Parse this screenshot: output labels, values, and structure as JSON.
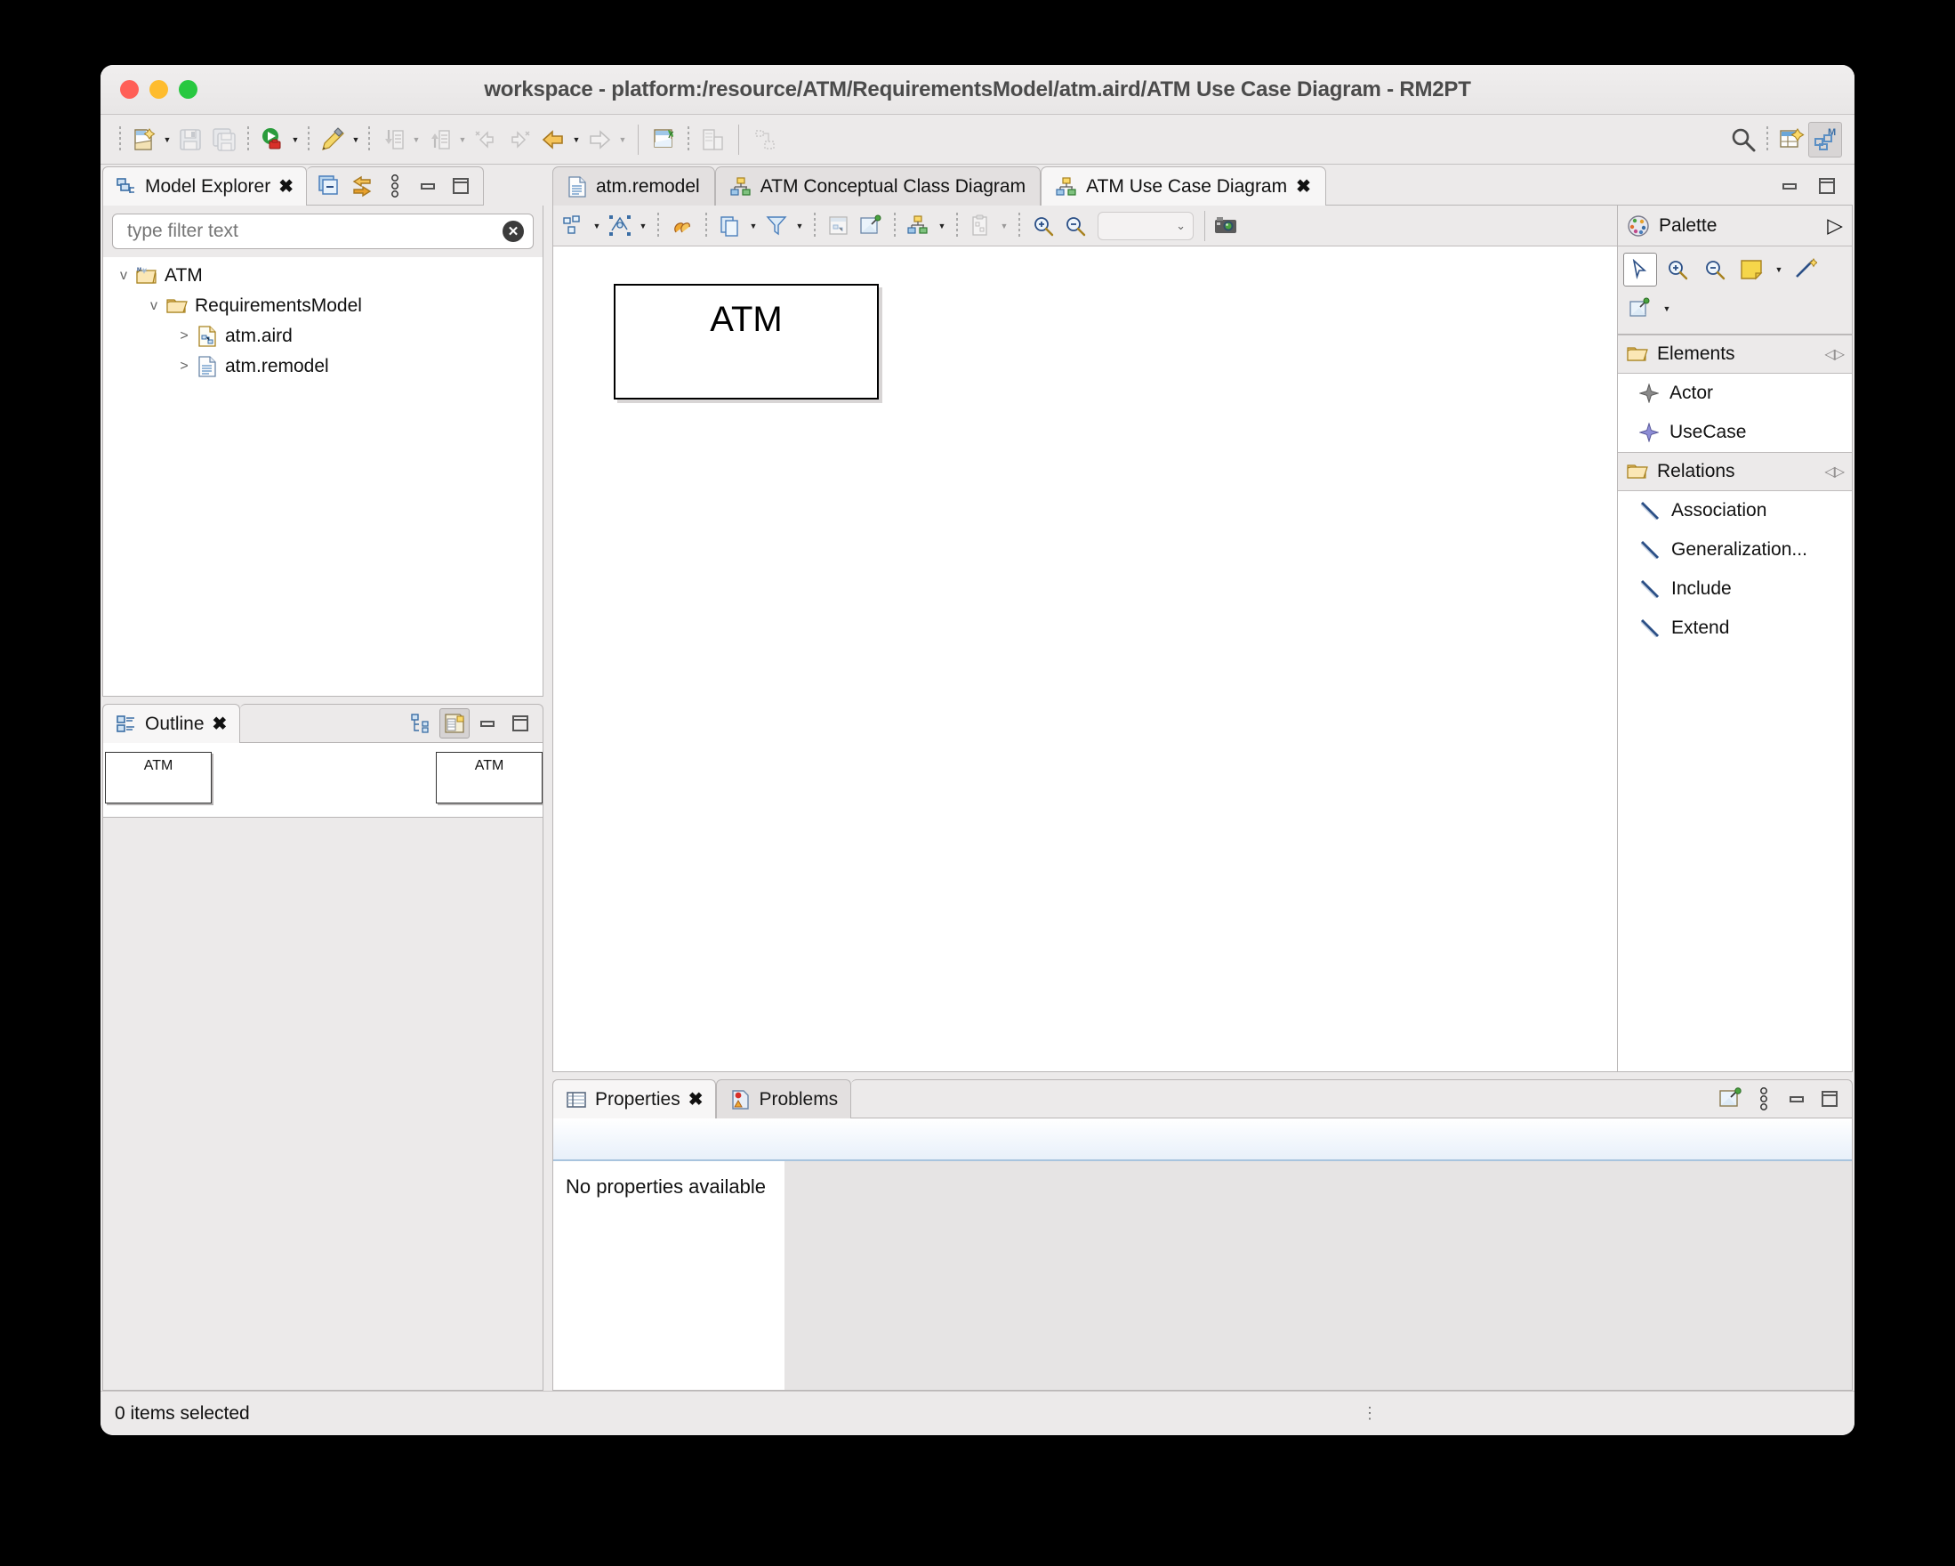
{
  "window": {
    "title": "workspace - platform:/resource/ATM/RequirementsModel/atm.aird/ATM Use Case Diagram - RM2PT",
    "controls": {
      "close": "close",
      "minimize": "minimize",
      "zoom": "zoom"
    }
  },
  "main_toolbar": {
    "items": [
      {
        "name": "new-wizard",
        "label": "New",
        "has_arrow": true,
        "enabled": true
      },
      {
        "name": "save",
        "label": "Save",
        "has_arrow": false,
        "enabled": false
      },
      {
        "name": "save-all",
        "label": "Save All",
        "has_arrow": false,
        "enabled": false
      },
      {
        "name": "run",
        "label": "Run",
        "has_arrow": true,
        "enabled": true
      },
      {
        "name": "debug-pen",
        "label": "Edit",
        "has_arrow": true,
        "enabled": true
      },
      {
        "name": "import",
        "label": "Import",
        "has_arrow": true,
        "enabled": false
      },
      {
        "name": "export",
        "label": "Export",
        "has_arrow": true,
        "enabled": false
      },
      {
        "name": "prev-annotation",
        "label": "Previous Annotation",
        "has_arrow": false,
        "enabled": false
      },
      {
        "name": "next-annotation",
        "label": "Next Annotation",
        "has_arrow": false,
        "enabled": false
      },
      {
        "name": "back",
        "label": "Back",
        "has_arrow": true,
        "enabled": true
      },
      {
        "name": "forward",
        "label": "Forward",
        "has_arrow": true,
        "enabled": false
      },
      {
        "name": "new-diagram",
        "label": "New Diagram",
        "has_arrow": false,
        "enabled": true
      },
      {
        "name": "new-representation",
        "label": "New Representation",
        "has_arrow": false,
        "enabled": false
      },
      {
        "name": "link-layout",
        "label": "Layout",
        "has_arrow": false,
        "enabled": false
      }
    ],
    "right": [
      {
        "name": "search",
        "label": "Search"
      },
      {
        "name": "open-perspective",
        "label": "Open Perspective"
      },
      {
        "name": "modeling-perspective",
        "label": "Modeling",
        "active": true
      }
    ]
  },
  "model_explorer": {
    "tab_label": "Model Explorer",
    "toolbar": [
      {
        "name": "collapse-all",
        "label": "Collapse All"
      },
      {
        "name": "link-with-editor",
        "label": "Link with Editor"
      },
      {
        "name": "view-menu",
        "label": "View Menu"
      },
      {
        "name": "minimize",
        "label": "Minimize"
      },
      {
        "name": "maximize",
        "label": "Maximize"
      }
    ],
    "filter": {
      "value": "",
      "placeholder": "type filter text",
      "clear_label": "Clear"
    },
    "tree": [
      {
        "label": "ATM",
        "icon": "project-icon",
        "depth": 0,
        "expanded": true,
        "twisty": "v"
      },
      {
        "label": "RequirementsModel",
        "icon": "folder-icon",
        "depth": 1,
        "expanded": true,
        "twisty": "v"
      },
      {
        "label": "atm.aird",
        "icon": "aird-file-icon",
        "depth": 2,
        "expanded": false,
        "twisty": ">"
      },
      {
        "label": "atm.remodel",
        "icon": "remodel-file-icon",
        "depth": 2,
        "expanded": false,
        "twisty": ">"
      }
    ]
  },
  "outline": {
    "tab_label": "Outline",
    "toolbar": [
      {
        "name": "tree-outline",
        "label": "Tree Outline",
        "selected": false
      },
      {
        "name": "overview-thumbnail",
        "label": "Overview",
        "selected": true
      },
      {
        "name": "minimize",
        "label": "Minimize",
        "selected": false
      },
      {
        "name": "maximize",
        "label": "Maximize",
        "selected": false
      }
    ],
    "thumbnails": [
      {
        "label": "ATM"
      },
      {
        "label": "ATM"
      }
    ]
  },
  "editor": {
    "tabs": [
      {
        "label": "atm.remodel",
        "icon": "remodel-file-icon",
        "active": false,
        "closable": false
      },
      {
        "label": "ATM Conceptual Class Diagram",
        "icon": "diagram-icon",
        "active": false,
        "closable": false
      },
      {
        "label": "ATM Use Case Diagram",
        "icon": "diagram-icon",
        "active": true,
        "closable": true
      }
    ],
    "window_buttons": [
      {
        "name": "minimize",
        "label": "Minimize"
      },
      {
        "name": "maximize",
        "label": "Maximize"
      }
    ],
    "diagram_toolbar": [
      {
        "name": "arrange-all",
        "label": "Arrange All",
        "has_arrow": true
      },
      {
        "name": "select-all",
        "label": "Select",
        "has_arrow": true
      },
      {
        "name": "refresh-diagram",
        "label": "Refresh",
        "has_arrow": false
      },
      {
        "name": "copy-appearance",
        "label": "Copy Appearance",
        "has_arrow": true
      },
      {
        "name": "filters",
        "label": "Filters",
        "has_arrow": true
      },
      {
        "name": "hide-element",
        "label": "Hide Element",
        "has_arrow": false
      },
      {
        "name": "pin-element",
        "label": "Pin Element",
        "has_arrow": false
      },
      {
        "name": "layers",
        "label": "Layers",
        "has_arrow": true
      },
      {
        "name": "paste-format",
        "label": "Paste Format",
        "has_arrow": true
      },
      {
        "name": "zoom-in",
        "label": "Zoom In",
        "has_arrow": false
      },
      {
        "name": "zoom-out",
        "label": "Zoom Out",
        "has_arrow": false
      }
    ],
    "zoom_combo": {
      "value": "",
      "name": "zoom-level-combo"
    },
    "screenshot_button": {
      "name": "export-image",
      "label": "Export as Image"
    },
    "canvas": {
      "nodes": [
        {
          "label": "ATM",
          "type": "package"
        }
      ]
    }
  },
  "palette": {
    "title": "Palette",
    "expand_label": "Show Palette",
    "tools": [
      {
        "name": "select-tool",
        "label": "Select",
        "selected": true
      },
      {
        "name": "zoom-in-tool",
        "label": "Zoom In",
        "selected": false
      },
      {
        "name": "zoom-out-tool",
        "label": "Zoom Out",
        "selected": false
      },
      {
        "name": "note-tool",
        "label": "Note",
        "selected": false,
        "has_arrow": true
      },
      {
        "name": "note-attachment-tool",
        "label": "Note Attachment",
        "selected": false
      },
      {
        "name": "generic-tool",
        "label": "Generic",
        "selected": false,
        "has_arrow": true
      }
    ],
    "sections": [
      {
        "title": "Elements",
        "name": "elements",
        "items": [
          {
            "label": "Actor",
            "icon": "actor-tool-icon",
            "color": "#6b6b6b"
          },
          {
            "label": "UseCase",
            "icon": "usecase-tool-icon",
            "color": "#7b7bd4"
          }
        ]
      },
      {
        "title": "Relations",
        "name": "relations",
        "items": [
          {
            "label": "Association",
            "icon": "association-tool-icon",
            "color": "#2b4f86"
          },
          {
            "label": "Generalization...",
            "icon": "generalization-tool-icon",
            "color": "#2b4f86"
          },
          {
            "label": "Include",
            "icon": "include-tool-icon",
            "color": "#2b4f86"
          },
          {
            "label": "Extend",
            "icon": "extend-tool-icon",
            "color": "#2b4f86"
          }
        ]
      }
    ]
  },
  "properties": {
    "tabs": [
      {
        "label": "Properties",
        "active": true,
        "closable": true,
        "icon": "properties-icon"
      },
      {
        "label": "Problems",
        "active": false,
        "closable": false,
        "icon": "problems-icon"
      }
    ],
    "toolbar": [
      {
        "name": "pin-properties",
        "label": "Pin to Selection"
      },
      {
        "name": "view-menu",
        "label": "View Menu"
      },
      {
        "name": "minimize",
        "label": "Minimize"
      },
      {
        "name": "maximize",
        "label": "Maximize"
      }
    ],
    "empty_message": "No properties available"
  },
  "status_bar": {
    "text": "0 items selected"
  },
  "colors": {
    "window_bg": "#eceaea",
    "accent_blue": "#4a7ebb",
    "folder_orange": "#e0a03c",
    "tab_active": "#f7f6f6"
  }
}
